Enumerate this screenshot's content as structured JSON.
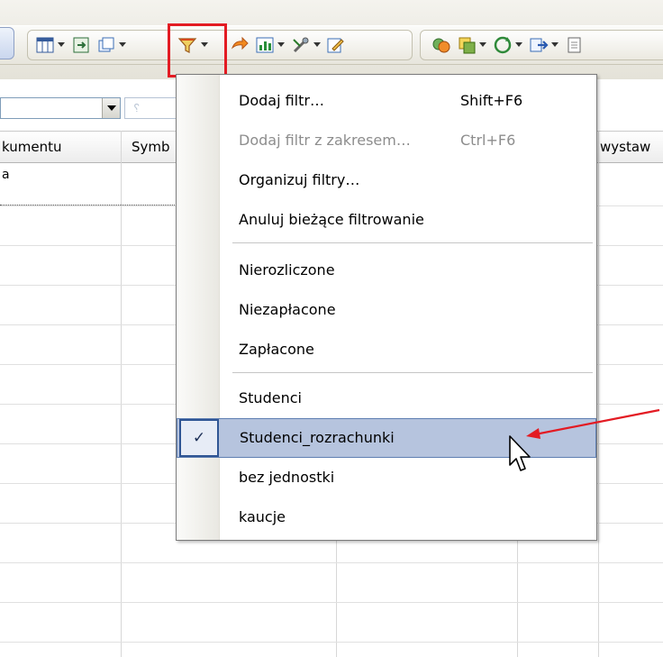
{
  "toolbar": {
    "icons": [
      "columns-icon",
      "export-icon",
      "copy-icon",
      "filter-icon",
      "arrow-icon",
      "chart-icon",
      "tools-icon",
      "edit-icon",
      "group-icon",
      "stack-icon",
      "refresh-icon",
      "forward-icon",
      "doc-icon"
    ],
    "highlight_color": "#e31b23"
  },
  "filter_field": {
    "hint": "␦"
  },
  "grid": {
    "columns": [
      "kumentu",
      "Symb",
      "wystaw"
    ],
    "first_cell": "a"
  },
  "menu": {
    "items": [
      {
        "label": "Dodaj filtr…",
        "shortcut": "Shift+F6",
        "disabled": false
      },
      {
        "label": "Dodaj filtr z zakresem…",
        "shortcut": "Ctrl+F6",
        "disabled": true
      },
      {
        "label": "Organizuj filtry…",
        "shortcut": "",
        "disabled": false
      },
      {
        "label": "Anuluj bieżące filtrowanie",
        "shortcut": "",
        "disabled": false
      },
      {
        "label": "Nierozliczone",
        "shortcut": "",
        "disabled": false
      },
      {
        "label": "Niezapłacone",
        "shortcut": "",
        "disabled": false
      },
      {
        "label": "Zapłacone",
        "shortcut": "",
        "disabled": false
      },
      {
        "label": "Studenci",
        "shortcut": "",
        "disabled": false
      },
      {
        "label": "Studenci_rozrachunki",
        "shortcut": "",
        "disabled": false,
        "checked": true,
        "selected": true
      },
      {
        "label": "bez jednostki",
        "shortcut": "",
        "disabled": false
      },
      {
        "label": "kaucje",
        "shortcut": "",
        "disabled": false
      }
    ],
    "check_glyph": "✓",
    "selection_color": "#b6c4de",
    "annotation_arrow_color": "#e31b23"
  }
}
